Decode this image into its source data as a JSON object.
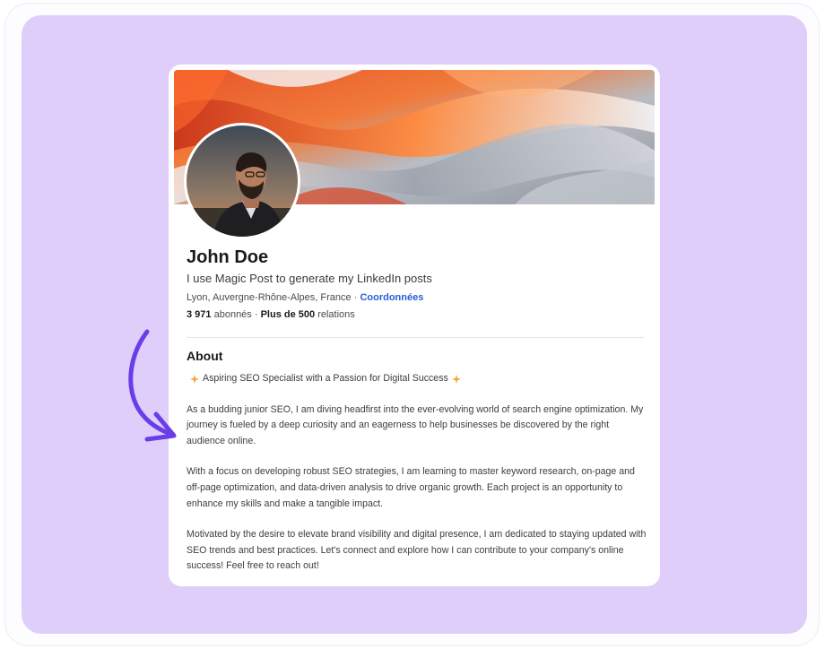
{
  "profile": {
    "name": "John Doe",
    "headline": "I use Magic Post to generate my LinkedIn posts",
    "location": "Lyon, Auvergne-Rhône-Alpes, France",
    "location_sep": " · ",
    "contact_label": "Coordonnées",
    "followers_count": "3 971",
    "followers_label": "abonnés",
    "stats_sep": " · ",
    "connections_count": "Plus de 500",
    "connections_label": "relations"
  },
  "about": {
    "title": "About",
    "tagline": "Aspiring SEO Specialist with a Passion for Digital Success",
    "paragraphs": [
      "As a budding junior SEO, I am diving headfirst into the ever-evolving world of search engine optimization. My journey is fueled by a deep curiosity and an eagerness to help businesses be discovered by the right audience online.",
      "With a focus on developing robust SEO strategies, I am learning to master keyword research, on-page and off-page optimization, and data-driven analysis to drive organic growth. Each project is an opportunity to enhance my skills and make a tangible impact.",
      "Motivated by the desire to elevate brand visibility and digital presence, I am dedicated to staying updated with SEO trends and best practices. Let's connect and explore how I can contribute to your company's online success! Feel free to reach out!"
    ]
  },
  "colors": {
    "background": "#dfcef9",
    "card": "#ffffff",
    "link": "#2a5fd6",
    "arrow": "#6a3de8"
  },
  "icons": {
    "tagline_icon": "sparkle-star-icon",
    "arrow": "curved-arrow-icon"
  }
}
